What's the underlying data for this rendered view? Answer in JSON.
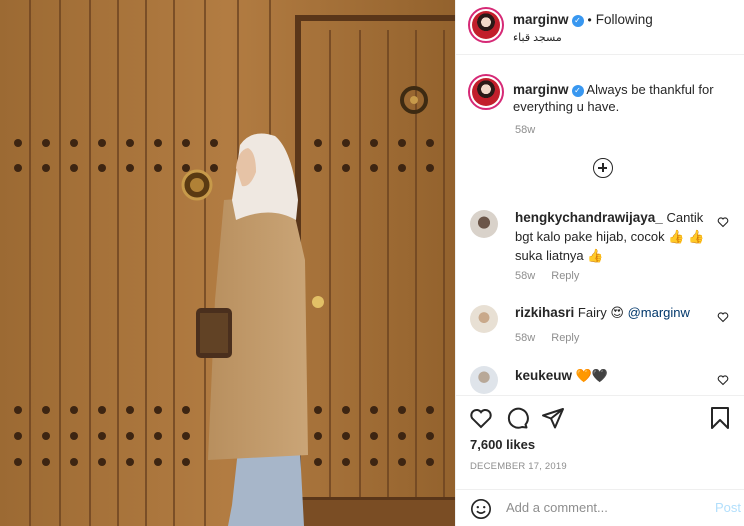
{
  "post": {
    "username": "marginw",
    "verified_mark": "✓",
    "dot": "•",
    "follow_label": "Following",
    "location": "مسجد قباء",
    "caption_username": "marginw",
    "caption_text": "Always be thankful for everything u have.",
    "caption_time": "58w",
    "photo_description": "Woman in beige coat and white hijab standing against large wooden studded doors",
    "icon_names": [
      "verified-badge-icon",
      "load-more-icon",
      "heart-icon",
      "comment-icon",
      "share-icon",
      "bookmark-icon",
      "smiley-icon"
    ]
  },
  "comments": [
    {
      "username": "hengkychandrawijaya_",
      "text": "Cantik bgt kalo pake hijab, cocok 👍 👍 suka liatnya 👍",
      "time": "58w",
      "reply": "Reply"
    },
    {
      "username": "rizkihasri",
      "text": "Fairy 😍 ",
      "mention": "@marginw",
      "time": "58w",
      "reply": "Reply"
    },
    {
      "username": "keukeuw",
      "text": "🧡🖤"
    }
  ],
  "footer": {
    "likes": "7,600 likes",
    "date": "DECEMBER 17, 2019",
    "comment_placeholder": "Add a comment...",
    "post_label": "Post"
  },
  "colors": {
    "accent_blue": "#3897f0",
    "post_disabled": "#b2dffc",
    "wood": "#a8743a",
    "text_primary": "#262626",
    "text_secondary": "#8e8e8e"
  }
}
